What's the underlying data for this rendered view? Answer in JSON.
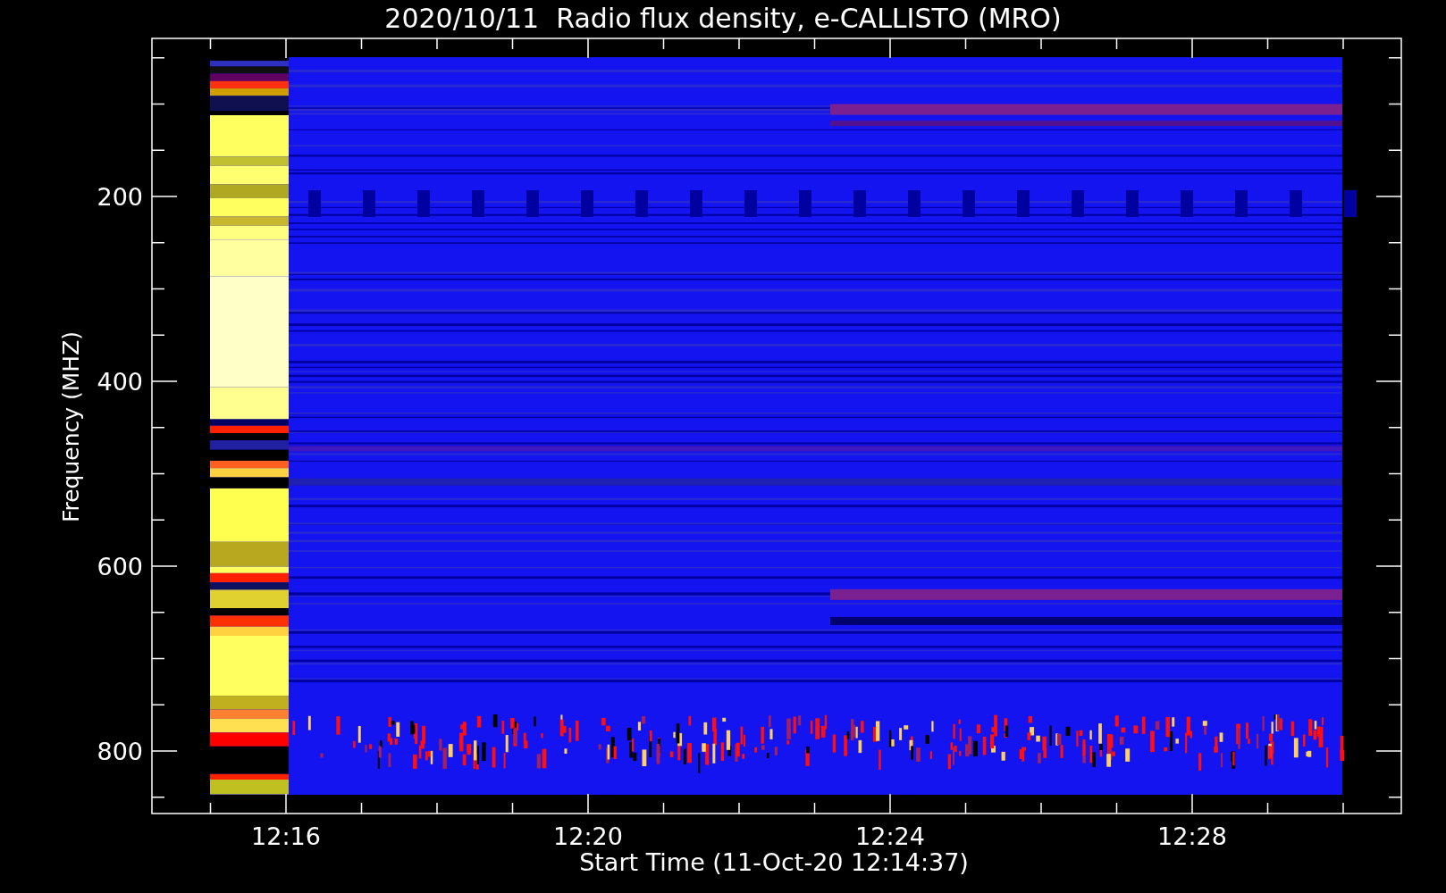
{
  "title": "2020/10/11  Radio flux density, e-CALLISTO (MRO)",
  "y_axis": {
    "label": "Frequency (MHZ)",
    "ticks": [
      "200",
      "400",
      "600",
      "800"
    ]
  },
  "x_axis": {
    "label": "Start Time (11-Oct-20 12:14:37)",
    "ticks": [
      "12:16",
      "12:20",
      "12:24",
      "12:28"
    ]
  }
}
